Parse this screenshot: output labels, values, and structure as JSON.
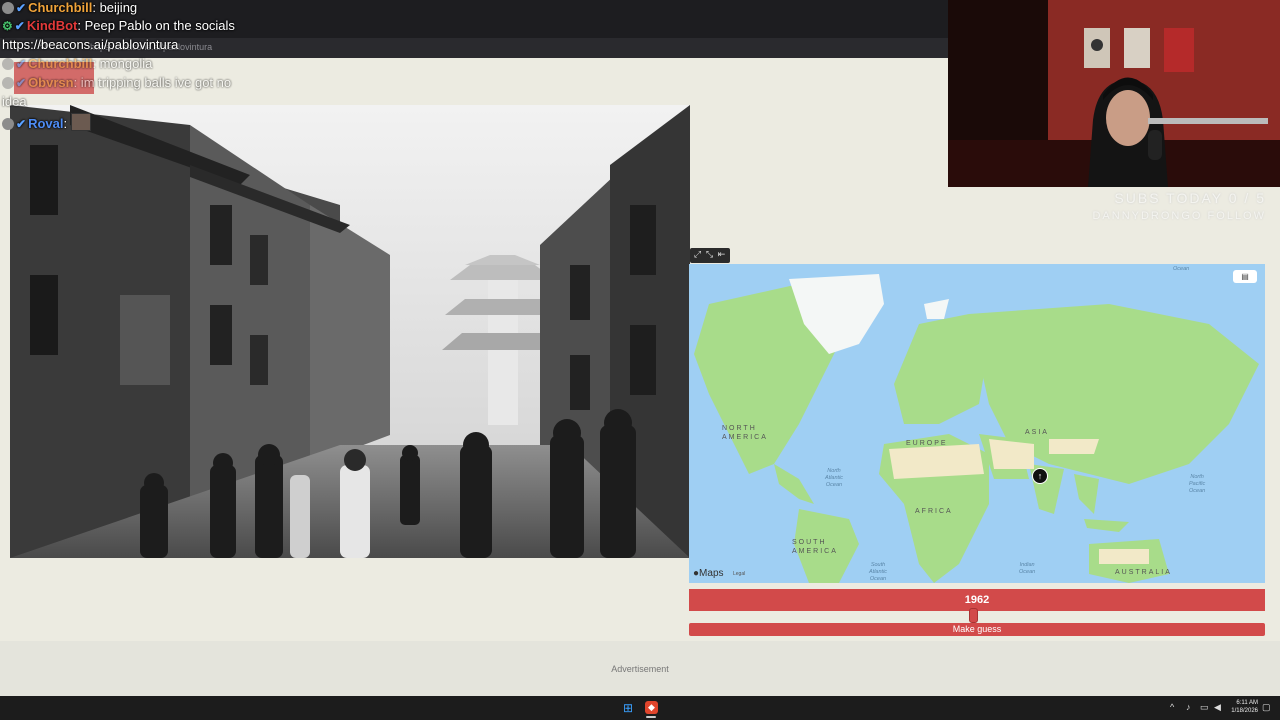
{
  "browser": {
    "address": "https://beacons.ai/pablovintura"
  },
  "chat": {
    "messages": [
      {
        "user": "Churchbill",
        "text": ": beijing",
        "color": "#f0a33a"
      },
      {
        "user": "KindBot",
        "text": ": Peep Pablo on the socials",
        "color": "#e23a3a"
      },
      {
        "user": "",
        "text": "https://beacons.ai/pablovintura",
        "color": "#ffffff"
      },
      {
        "user": "Churchbill",
        "text": ": mongolia",
        "color": "#f0a33a"
      },
      {
        "user": "Obvrsn",
        "text": ": im tripping balls ive got no",
        "color": "#f0a33a"
      },
      {
        "user": "",
        "text": "idea",
        "color": "#ffffff"
      },
      {
        "user": "Roval",
        "text": ":",
        "color": "#4f8df5"
      }
    ]
  },
  "map": {
    "labels": {
      "north_america": "NORTH\nAMERICA",
      "europe": "EUROPE",
      "asia": "ASIA",
      "africa": "AFRICA",
      "south_america": "SOUTH\nAMERICA",
      "australia": "AUSTRALIA"
    },
    "oceans": {
      "north_atlantic": "North\nAtlantic\nOcean",
      "north_pacific": "North\nPacific\nOcean",
      "south_atlantic": "South\nAtlantic\nOcean",
      "indian": "Indian\nOcean",
      "arctic": "Ocean"
    },
    "brand": "Maps",
    "legal": "Legal",
    "marker_icon": "pin-icon"
  },
  "controls": {
    "year": "1962",
    "year_fraction": 0.49,
    "guess_label": "Make guess"
  },
  "ad": {
    "label": "Advertisement"
  },
  "stream_overlay": {
    "subs": "SUBS TODAY 0 / 5",
    "follow": "DANNYDRONGO FOLLOW"
  },
  "taskbar": {
    "time": "6:11 AM",
    "date": "1/18/2026"
  },
  "colors": {
    "accent_red": "#d24a4a",
    "page_bg": "#ecebe1",
    "map_water": "#9fcff3",
    "map_land": "#a8dc8a"
  }
}
